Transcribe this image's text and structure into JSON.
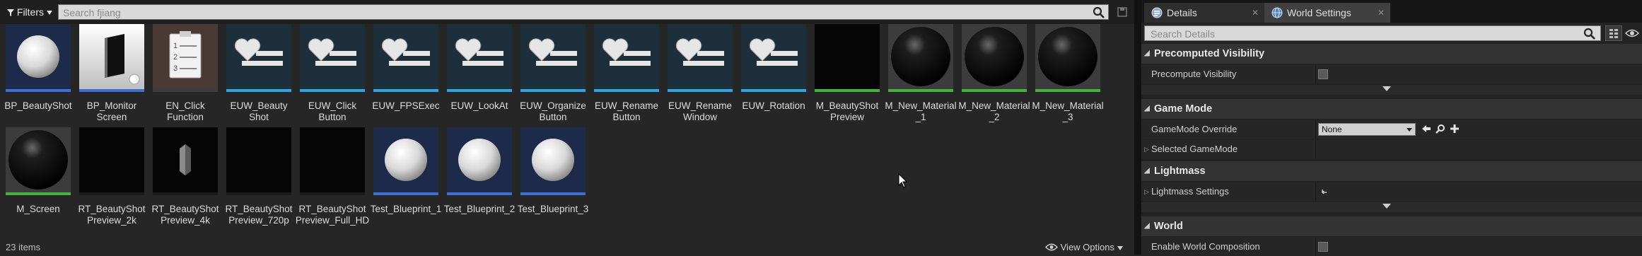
{
  "content_browser": {
    "filters_label": "Filters",
    "search_placeholder": "Search fjiang",
    "items_count": "23 items",
    "view_options_label": "View Options",
    "assets": [
      {
        "label": "BP_BeautyShot",
        "thumb": "white-sphere-icon",
        "strip": "#3d6fd6"
      },
      {
        "label": "BP_Monitor\nScreen",
        "thumb": "monitor-icon",
        "strip": "#3d6fd6"
      },
      {
        "label": "EN_Click\nFunction",
        "thumb": "list-notepad-icon",
        "strip": "#3d3d3d"
      },
      {
        "label": "EUW_Beauty\nShot",
        "thumb": "heart-list-icon",
        "strip": "#29a7e1"
      },
      {
        "label": "EUW_Click\nButton",
        "thumb": "heart-list-icon",
        "strip": "#29a7e1"
      },
      {
        "label": "EUW_FPSExec",
        "thumb": "heart-list-icon",
        "strip": "#29a7e1"
      },
      {
        "label": "EUW_LookAt",
        "thumb": "heart-list-icon",
        "strip": "#29a7e1"
      },
      {
        "label": "EUW_Organize\nButton",
        "thumb": "heart-list-icon",
        "strip": "#29a7e1"
      },
      {
        "label": "EUW_Rename\nButton",
        "thumb": "heart-list-icon",
        "strip": "#29a7e1"
      },
      {
        "label": "EUW_Rename\nWindow",
        "thumb": "heart-list-icon",
        "strip": "#29a7e1"
      },
      {
        "label": "EUW_Rotation",
        "thumb": "heart-list-icon",
        "strip": "#29a7e1"
      },
      {
        "label": "M_BeautyShot\nPreview",
        "thumb": "black-square-icon",
        "strip": "#43b33a"
      },
      {
        "label": "M_New_Material\n_1",
        "thumb": "black-sphere-icon",
        "strip": "#43b33a"
      },
      {
        "label": "M_New_Material\n_2",
        "thumb": "black-sphere-icon",
        "strip": "#43b33a"
      },
      {
        "label": "M_New_Material\n_3",
        "thumb": "black-sphere-icon",
        "strip": "#43b33a"
      },
      {
        "label": "M_Screen",
        "thumb": "black-sphere-icon",
        "strip": "#43b33a"
      },
      {
        "label": "RT_BeautyShot\nPreview_2k",
        "thumb": "black-square-icon",
        "strip": "#1a1a1a"
      },
      {
        "label": "RT_BeautyShot\nPreview_4k",
        "thumb": "gray-prism-icon",
        "strip": "#1a1a1a"
      },
      {
        "label": "RT_BeautyShot\nPreview_720p",
        "thumb": "black-square-icon",
        "strip": "#1a1a1a"
      },
      {
        "label": "RT_BeautyShot\nPreview_Full_HD",
        "thumb": "black-square-icon",
        "strip": "#1a1a1a"
      },
      {
        "label": "Test_Blueprint_1",
        "thumb": "white-sphere-icon",
        "strip": "#3d6fd6"
      },
      {
        "label": "Test_Blueprint_2",
        "thumb": "white-sphere-icon",
        "strip": "#3d6fd6"
      },
      {
        "label": "Test_Blueprint_3",
        "thumb": "white-sphere-icon",
        "strip": "#3d6fd6"
      }
    ]
  },
  "details_panel": {
    "tabs": [
      {
        "label": "Details",
        "icon": "details-icon"
      },
      {
        "label": "World Settings",
        "icon": "globe-icon"
      }
    ],
    "search_placeholder": "Search Details",
    "categories": {
      "precomputed_visibility": {
        "title": "Precomputed Visibility",
        "rows": [
          {
            "label": "Precompute Visibility",
            "checked": false
          }
        ]
      },
      "game_mode": {
        "title": "Game Mode",
        "rows": [
          {
            "label": "GameMode Override",
            "value": "None"
          },
          {
            "label": "Selected GameMode"
          }
        ]
      },
      "lightmass": {
        "title": "Lightmass",
        "rows": [
          {
            "label": "Lightmass Settings"
          }
        ]
      },
      "world": {
        "title": "World",
        "rows": [
          {
            "label": "Enable World Composition",
            "checked": false
          }
        ]
      }
    }
  }
}
